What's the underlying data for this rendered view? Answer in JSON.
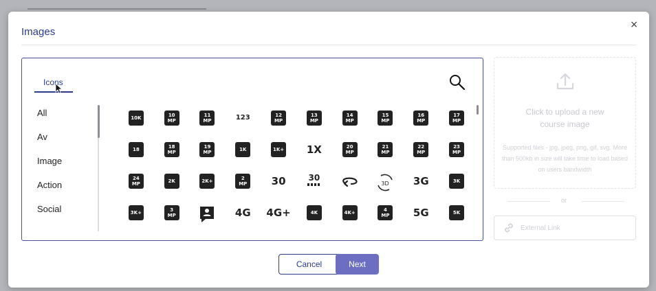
{
  "modal": {
    "title": "Images",
    "close_label": "×"
  },
  "picker": {
    "tab_label": "Icons",
    "categories": [
      "All",
      "Av",
      "Image",
      "Action",
      "Social"
    ],
    "icons": [
      [
        {
          "t": "badge",
          "a": "10K",
          "name": "10k-icon"
        },
        {
          "t": "badge2",
          "a": "10",
          "b": "MP",
          "name": "10mp-icon"
        },
        {
          "t": "badge2",
          "a": "11",
          "b": "MP",
          "name": "11mp-icon"
        },
        {
          "t": "plain-small",
          "a": "123",
          "name": "123-icon"
        },
        {
          "t": "badge2",
          "a": "12",
          "b": "MP",
          "name": "12mp-icon"
        },
        {
          "t": "badge2",
          "a": "13",
          "b": "MP",
          "name": "13mp-icon"
        },
        {
          "t": "badge2",
          "a": "14",
          "b": "MP",
          "name": "14mp-icon"
        },
        {
          "t": "badge2",
          "a": "15",
          "b": "MP",
          "name": "15mp-icon"
        },
        {
          "t": "badge2",
          "a": "16",
          "b": "MP",
          "name": "16mp-icon"
        },
        {
          "t": "badge2",
          "a": "17",
          "b": "MP",
          "name": "17mp-icon"
        }
      ],
      [
        {
          "t": "badge",
          "a": "18",
          "name": "18-up-rating-icon"
        },
        {
          "t": "badge2",
          "a": "18",
          "b": "MP",
          "name": "18mp-icon"
        },
        {
          "t": "badge2",
          "a": "19",
          "b": "MP",
          "name": "19mp-icon"
        },
        {
          "t": "badge",
          "a": "1K",
          "name": "1k-icon"
        },
        {
          "t": "badge",
          "a": "1K+",
          "name": "1k-plus-icon"
        },
        {
          "t": "plain",
          "a": "1X",
          "name": "1x-icon"
        },
        {
          "t": "badge2",
          "a": "20",
          "b": "MP",
          "name": "20mp-icon"
        },
        {
          "t": "badge2",
          "a": "21",
          "b": "MP",
          "name": "21mp-icon"
        },
        {
          "t": "badge2",
          "a": "22",
          "b": "MP",
          "name": "22mp-icon"
        },
        {
          "t": "badge2",
          "a": "23",
          "b": "MP",
          "name": "23mp-icon"
        }
      ],
      [
        {
          "t": "badge2",
          "a": "24",
          "b": "MP",
          "name": "24mp-icon"
        },
        {
          "t": "badge",
          "a": "2K",
          "name": "2k-icon"
        },
        {
          "t": "badge",
          "a": "2K+",
          "name": "2k-plus-icon"
        },
        {
          "t": "badge2",
          "a": "2",
          "b": "MP",
          "name": "2mp-icon"
        },
        {
          "t": "plain",
          "a": "30",
          "name": "30fps-icon"
        },
        {
          "t": "plain-stack",
          "a": "30",
          "name": "30fps-select-icon"
        },
        {
          "t": "svg",
          "a": "rotate",
          "name": "360-icon"
        },
        {
          "t": "svg",
          "a": "3d",
          "name": "3d-rotation-icon"
        },
        {
          "t": "plain",
          "a": "3G",
          "name": "3g-mobiledata-icon"
        },
        {
          "t": "badge",
          "a": "3K",
          "name": "3k-icon"
        }
      ],
      [
        {
          "t": "badge",
          "a": "3K+",
          "name": "3k-plus-icon"
        },
        {
          "t": "badge2",
          "a": "3",
          "b": "MP",
          "name": "3mp-icon"
        },
        {
          "t": "svg",
          "a": "account",
          "name": "account-box-icon"
        },
        {
          "t": "plain",
          "a": "4G",
          "name": "4g-mobiledata-icon"
        },
        {
          "t": "plain",
          "a": "4G+",
          "name": "4g-plus-mobiledata-icon"
        },
        {
          "t": "badge",
          "a": "4K",
          "name": "4k-icon"
        },
        {
          "t": "badge",
          "a": "4K+",
          "name": "4k-plus-icon"
        },
        {
          "t": "badge2",
          "a": "4",
          "b": "MP",
          "name": "4mp-icon"
        },
        {
          "t": "plain",
          "a": "5G",
          "name": "5g-icon"
        },
        {
          "t": "badge",
          "a": "5K",
          "name": "5k-icon"
        }
      ]
    ]
  },
  "upload": {
    "title": "Click to upload a new course image",
    "note": "Supported files - jpg, jpeg, png, gif, svg. More than 500kb in size will take time to load based on users bandwidth",
    "or_label": "or",
    "link_placeholder": "External Link"
  },
  "footer": {
    "cancel_label": "Cancel",
    "next_label": "Next"
  },
  "colors": {
    "accent": "#2b3a8c",
    "next_button": "#6c6fc1",
    "icon_fill": "#222222"
  }
}
